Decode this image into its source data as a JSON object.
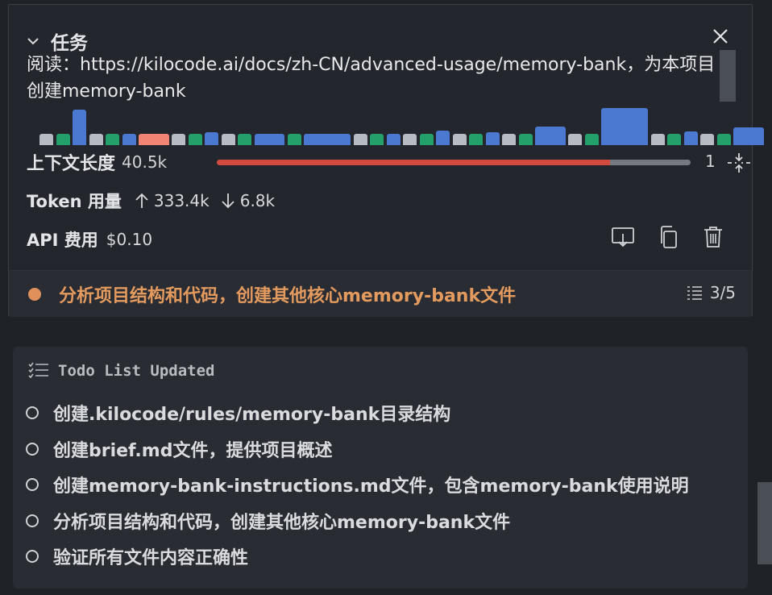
{
  "task": {
    "title": "任务",
    "text": "阅读：https://kilocode.ai/docs/zh-CN/advanced-usage/memory-bank，为本项目创建memory-bank"
  },
  "context_bars": [
    {
      "h": 0.3,
      "c": "#b7bcc4"
    },
    {
      "h": 0.3,
      "c": "#24a06b"
    },
    {
      "h": 0.95,
      "c": "#4b78d1"
    },
    {
      "h": 0.3,
      "c": "#b7bcc4"
    },
    {
      "h": 0.3,
      "c": "#24a06b"
    },
    {
      "h": 0.3,
      "c": "#4b78d1"
    },
    {
      "h": 0.3,
      "c": "#f28474",
      "w": 2
    },
    {
      "h": 0.3,
      "c": "#b7bcc4"
    },
    {
      "h": 0.3,
      "c": "#24a06b"
    },
    {
      "h": 0.35,
      "c": "#4b78d1"
    },
    {
      "h": 0.3,
      "c": "#b7bcc4"
    },
    {
      "h": 0.3,
      "c": "#24a06b"
    },
    {
      "h": 0.3,
      "c": "#4b78d1",
      "w": 2
    },
    {
      "h": 0.3,
      "c": "#24a06b"
    },
    {
      "h": 0.3,
      "c": "#4b78d1",
      "w": 3
    },
    {
      "h": 0.3,
      "c": "#b7bcc4"
    },
    {
      "h": 0.3,
      "c": "#24a06b"
    },
    {
      "h": 0.3,
      "c": "#4b78d1"
    },
    {
      "h": 0.3,
      "c": "#b7bcc4"
    },
    {
      "h": 0.3,
      "c": "#24a06b"
    },
    {
      "h": 0.4,
      "c": "#4b78d1"
    },
    {
      "h": 0.3,
      "c": "#b7bcc4"
    },
    {
      "h": 0.3,
      "c": "#24a06b"
    },
    {
      "h": 0.35,
      "c": "#4b78d1"
    },
    {
      "h": 0.3,
      "c": "#b7bcc4"
    },
    {
      "h": 0.3,
      "c": "#24a06b"
    },
    {
      "h": 0.5,
      "c": "#4b78d1",
      "w": 2
    },
    {
      "h": 0.3,
      "c": "#b7bcc4"
    },
    {
      "h": 0.3,
      "c": "#24a06b"
    },
    {
      "h": 1.0,
      "c": "#4b78d1",
      "w": 3
    },
    {
      "h": 0.3,
      "c": "#b7bcc4"
    },
    {
      "h": 0.3,
      "c": "#24a06b"
    },
    {
      "h": 0.38,
      "c": "#4b78d1"
    },
    {
      "h": 0.3,
      "c": "#b7bcc4"
    },
    {
      "h": 0.3,
      "c": "#24a06b"
    },
    {
      "h": 0.48,
      "c": "#4b78d1",
      "w": 2
    }
  ],
  "context": {
    "label": "上下文长度",
    "value": "40.5k",
    "progress": 0.83,
    "max_label": "1",
    "progress_color": "#d2493f"
  },
  "tokens": {
    "label": "Token 用量",
    "up": "333.4k",
    "down": "6.8k"
  },
  "api": {
    "label": "API 费用",
    "cost": "$0.10"
  },
  "current_todo": {
    "text": "分析项目结构和代码，创建其他核心memory-bank文件",
    "count": "3/5",
    "accent": "#e39a5e"
  },
  "todo_list": {
    "title": "Todo List Updated",
    "items": [
      "创建.kilocode/rules/memory-bank目录结构",
      "创建brief.md文件，提供项目概述",
      "创建memory-bank-instructions.md文件，包含memory-bank使用说明",
      "分析项目结构和代码，创建其他核心memory-bank文件",
      "验证所有文件内容正确性"
    ]
  }
}
